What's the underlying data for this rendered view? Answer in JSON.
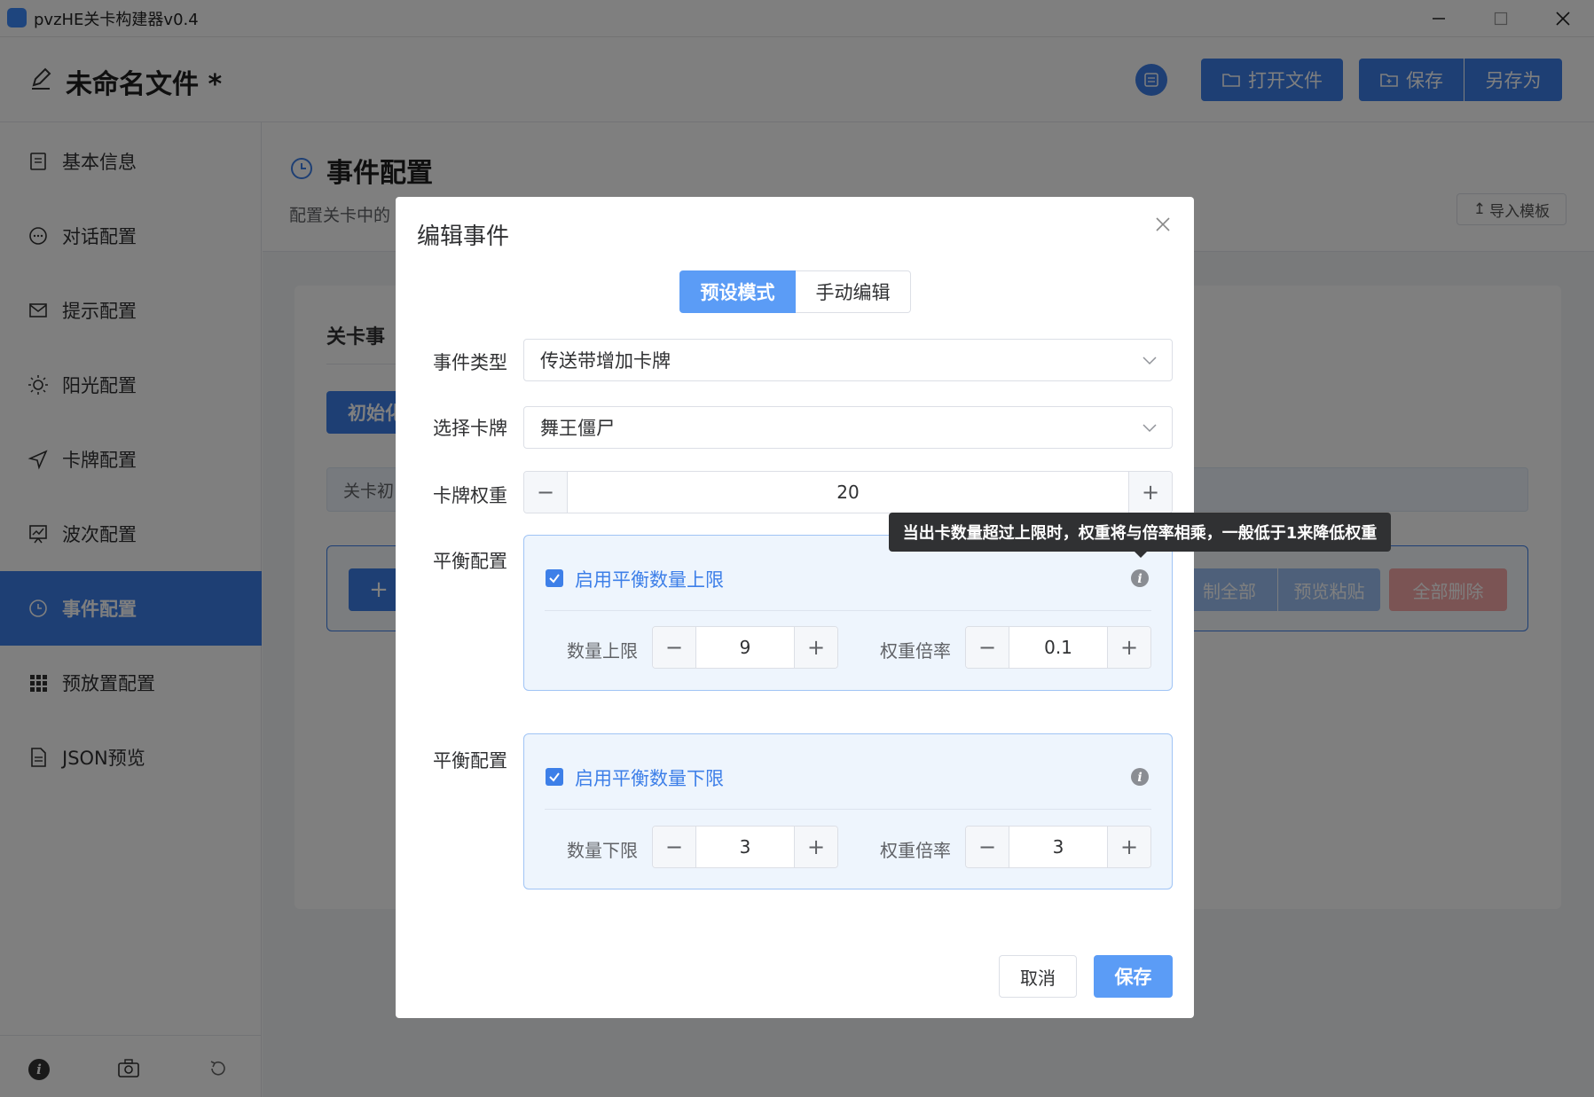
{
  "window": {
    "title": "pvzHE关卡构建器v0.4",
    "controls": [
      "minimize",
      "maximize",
      "close"
    ]
  },
  "header": {
    "doc_title": "未命名文件 *",
    "open_file": "打开文件",
    "save": "保存",
    "save_as": "另存为"
  },
  "sidebar": {
    "items": [
      {
        "label": "基本信息",
        "icon": "document-icon"
      },
      {
        "label": "对话配置",
        "icon": "chat-icon"
      },
      {
        "label": "提示配置",
        "icon": "mail-icon"
      },
      {
        "label": "阳光配置",
        "icon": "sun-icon"
      },
      {
        "label": "卡牌配置",
        "icon": "send-icon"
      },
      {
        "label": "波次配置",
        "icon": "chart-icon"
      },
      {
        "label": "事件配置",
        "icon": "clock-icon",
        "active": true
      },
      {
        "label": "预放置配置",
        "icon": "grid-icon"
      },
      {
        "label": "JSON预览",
        "icon": "file-icon"
      }
    ]
  },
  "page": {
    "title": "事件配置",
    "subtitle_visible": "配置关卡中的",
    "import_template": "导入模板",
    "card_title_partial": "关卡事",
    "tab_partial": "初始化",
    "info_row_partial": "关卡初",
    "bg_buttons": [
      "制全部",
      "预览粘贴",
      "全部删除"
    ]
  },
  "dialog": {
    "title": "编辑事件",
    "mode_preset": "预设模式",
    "mode_manual": "手动编辑",
    "event_type_label": "事件类型",
    "event_type_value": "传送带增加卡牌",
    "card_label": "选择卡牌",
    "card_value": "舞王僵尸",
    "weight_label": "卡牌权重",
    "weight_value": "20",
    "balance_upper": {
      "section_label": "平衡配置",
      "checkbox_label": "启用平衡数量上限",
      "checked": true,
      "limit_label": "数量上限",
      "limit_value": "9",
      "multiplier_label": "权重倍率",
      "multiplier_value": "0.1"
    },
    "balance_lower": {
      "section_label": "平衡配置",
      "checkbox_label": "启用平衡数量下限",
      "checked": true,
      "limit_label": "数量下限",
      "limit_value": "3",
      "multiplier_label": "权重倍率",
      "multiplier_value": "3"
    },
    "tooltip": "当出卡数量超过上限时，权重将与倍率相乘，一般低于1来降低权重",
    "cancel": "取消",
    "save": "保存"
  },
  "colors": {
    "primary": "#3d7fe8",
    "primary_light": "#5b9cf6",
    "panel_bg": "#eef5fd"
  }
}
